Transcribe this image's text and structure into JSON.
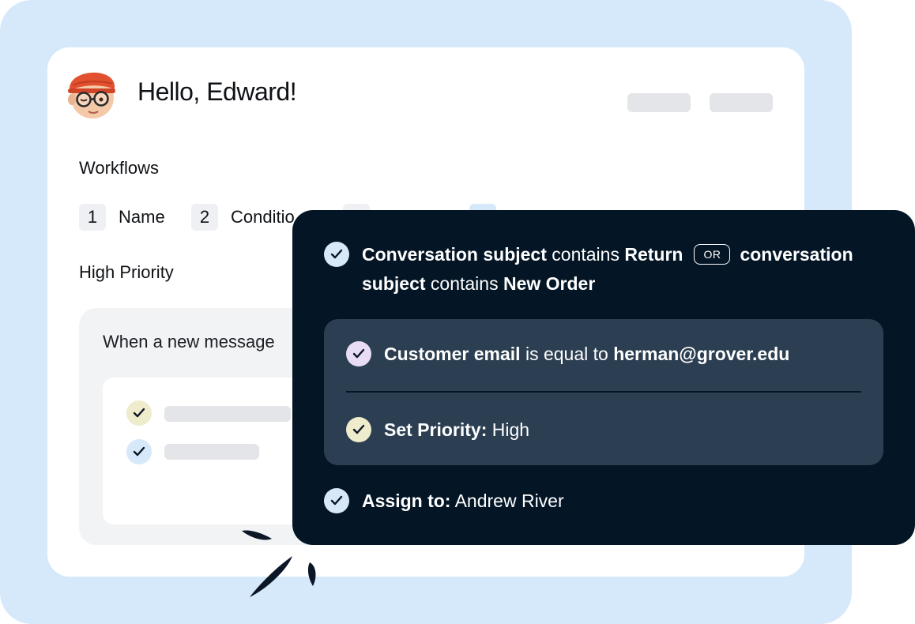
{
  "colors": {
    "background_panel": "#d6e9fb",
    "dark_card": "#041626",
    "nested_card": "#2c3f52",
    "check_blue": "#d6e9fb",
    "check_purple": "#e8ddf5",
    "check_yellow": "#eeeccc"
  },
  "header": {
    "greeting": "Hello, Edward!",
    "avatar_icon": "memoji-avatar"
  },
  "workflows": {
    "title": "Workflows",
    "steps": [
      {
        "number": "1",
        "label": "Name"
      },
      {
        "number": "2",
        "label": "Conditio"
      }
    ],
    "priority_title": "High Priority",
    "message_text": "When a new message"
  },
  "rule": {
    "condition": {
      "field1": "Conversation subject",
      "op1": "contains",
      "value1": "Return",
      "or_label": "OR",
      "field2a": "conversation",
      "field2b": "subject",
      "op2": "contains",
      "value2": "New Order"
    },
    "nested": {
      "email_field": "Customer email",
      "email_op": "is equal to",
      "email_value": "herman@grover.edu",
      "priority_label": "Set Priority:",
      "priority_value": "High"
    },
    "assign": {
      "label": "Assign to:",
      "value": "Andrew River"
    }
  }
}
